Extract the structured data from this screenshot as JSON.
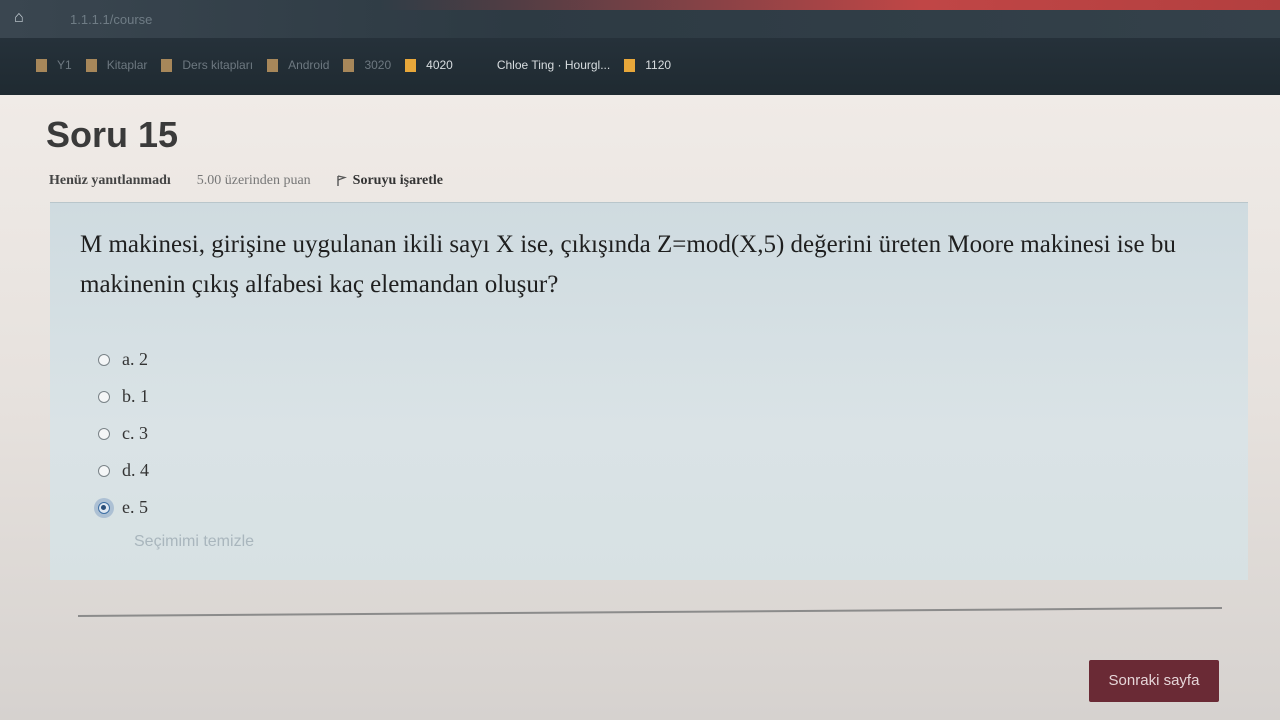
{
  "browser": {
    "url_text": "1.1.1.1/course",
    "bookmarks": [
      {
        "label": "Y1",
        "dim": true
      },
      {
        "label": "Kitaplar",
        "dim": true
      },
      {
        "label": "Ders kitapları",
        "dim": true
      },
      {
        "label": "Android",
        "dim": true
      },
      {
        "label": "3020",
        "dim": true
      },
      {
        "label": "4020",
        "dim": false
      },
      {
        "label": "Chloe Ting · Hourgl...",
        "dim": false,
        "no_folder": true
      },
      {
        "label": "1120",
        "dim": false
      }
    ]
  },
  "question": {
    "title": "Soru 15",
    "status": "Henüz yanıtlanmadı",
    "points": "5.00 üzerinden puan",
    "flag_label": "Soruyu işaretle",
    "text": "M makinesi, girişine uygulanan ikili sayı X ise, çıkışında Z=mod(X,5) değerini üreten Moore makinesi ise bu makinenin çıkış alfabesi kaç elemandan oluşur?",
    "answers": [
      {
        "label": "a. 2",
        "selected": false
      },
      {
        "label": "b. 1",
        "selected": false
      },
      {
        "label": "c. 3",
        "selected": false
      },
      {
        "label": "d. 4",
        "selected": false
      },
      {
        "label": "e. 5",
        "selected": true
      }
    ],
    "clear_label": "Seçimimi temizle"
  },
  "navigation": {
    "next_label": "Sonraki sayfa"
  },
  "colors": {
    "next_button_bg": "#6a2a35",
    "question_box_bg": "#d5e0e4",
    "bookmark_folder": "#e8a73a"
  }
}
